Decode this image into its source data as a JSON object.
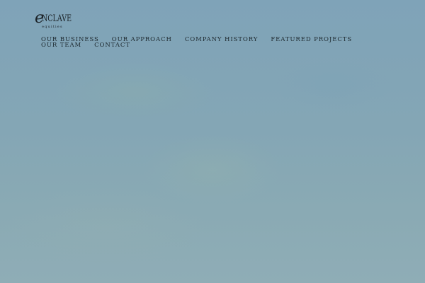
{
  "brand": {
    "name": "NCLAVE",
    "initial": "e",
    "tagline": "equities"
  },
  "nav": {
    "items": [
      {
        "label": "OUR BUSINESS"
      },
      {
        "label": "OUR APPROACH"
      },
      {
        "label": "COMPANY HISTORY"
      },
      {
        "label": "FEATURED PROJECTS"
      },
      {
        "label": "OUR TEAM"
      },
      {
        "label": "CONTACT"
      }
    ]
  },
  "colors": {
    "background": "#84a6b5",
    "nav_text": "#1e2a30",
    "logo": "#1c2328"
  }
}
